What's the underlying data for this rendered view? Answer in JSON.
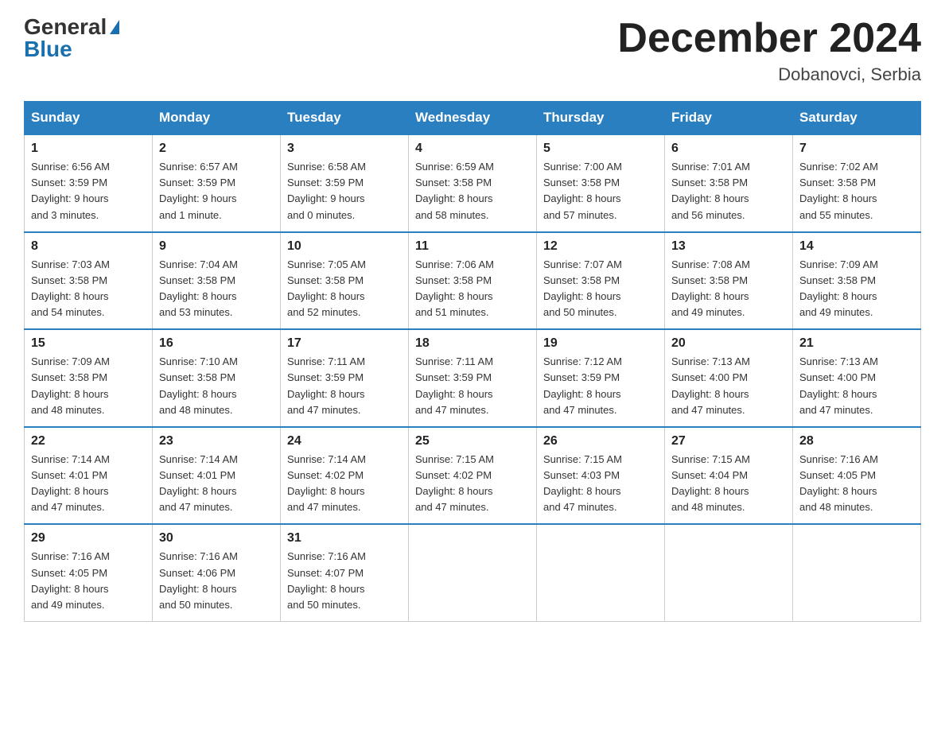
{
  "header": {
    "logo_general": "General",
    "logo_blue": "Blue",
    "month_title": "December 2024",
    "location": "Dobanovci, Serbia"
  },
  "weekdays": [
    "Sunday",
    "Monday",
    "Tuesday",
    "Wednesday",
    "Thursday",
    "Friday",
    "Saturday"
  ],
  "weeks": [
    [
      {
        "day": "1",
        "info": "Sunrise: 6:56 AM\nSunset: 3:59 PM\nDaylight: 9 hours\nand 3 minutes."
      },
      {
        "day": "2",
        "info": "Sunrise: 6:57 AM\nSunset: 3:59 PM\nDaylight: 9 hours\nand 1 minute."
      },
      {
        "day": "3",
        "info": "Sunrise: 6:58 AM\nSunset: 3:59 PM\nDaylight: 9 hours\nand 0 minutes."
      },
      {
        "day": "4",
        "info": "Sunrise: 6:59 AM\nSunset: 3:58 PM\nDaylight: 8 hours\nand 58 minutes."
      },
      {
        "day": "5",
        "info": "Sunrise: 7:00 AM\nSunset: 3:58 PM\nDaylight: 8 hours\nand 57 minutes."
      },
      {
        "day": "6",
        "info": "Sunrise: 7:01 AM\nSunset: 3:58 PM\nDaylight: 8 hours\nand 56 minutes."
      },
      {
        "day": "7",
        "info": "Sunrise: 7:02 AM\nSunset: 3:58 PM\nDaylight: 8 hours\nand 55 minutes."
      }
    ],
    [
      {
        "day": "8",
        "info": "Sunrise: 7:03 AM\nSunset: 3:58 PM\nDaylight: 8 hours\nand 54 minutes."
      },
      {
        "day": "9",
        "info": "Sunrise: 7:04 AM\nSunset: 3:58 PM\nDaylight: 8 hours\nand 53 minutes."
      },
      {
        "day": "10",
        "info": "Sunrise: 7:05 AM\nSunset: 3:58 PM\nDaylight: 8 hours\nand 52 minutes."
      },
      {
        "day": "11",
        "info": "Sunrise: 7:06 AM\nSunset: 3:58 PM\nDaylight: 8 hours\nand 51 minutes."
      },
      {
        "day": "12",
        "info": "Sunrise: 7:07 AM\nSunset: 3:58 PM\nDaylight: 8 hours\nand 50 minutes."
      },
      {
        "day": "13",
        "info": "Sunrise: 7:08 AM\nSunset: 3:58 PM\nDaylight: 8 hours\nand 49 minutes."
      },
      {
        "day": "14",
        "info": "Sunrise: 7:09 AM\nSunset: 3:58 PM\nDaylight: 8 hours\nand 49 minutes."
      }
    ],
    [
      {
        "day": "15",
        "info": "Sunrise: 7:09 AM\nSunset: 3:58 PM\nDaylight: 8 hours\nand 48 minutes."
      },
      {
        "day": "16",
        "info": "Sunrise: 7:10 AM\nSunset: 3:58 PM\nDaylight: 8 hours\nand 48 minutes."
      },
      {
        "day": "17",
        "info": "Sunrise: 7:11 AM\nSunset: 3:59 PM\nDaylight: 8 hours\nand 47 minutes."
      },
      {
        "day": "18",
        "info": "Sunrise: 7:11 AM\nSunset: 3:59 PM\nDaylight: 8 hours\nand 47 minutes."
      },
      {
        "day": "19",
        "info": "Sunrise: 7:12 AM\nSunset: 3:59 PM\nDaylight: 8 hours\nand 47 minutes."
      },
      {
        "day": "20",
        "info": "Sunrise: 7:13 AM\nSunset: 4:00 PM\nDaylight: 8 hours\nand 47 minutes."
      },
      {
        "day": "21",
        "info": "Sunrise: 7:13 AM\nSunset: 4:00 PM\nDaylight: 8 hours\nand 47 minutes."
      }
    ],
    [
      {
        "day": "22",
        "info": "Sunrise: 7:14 AM\nSunset: 4:01 PM\nDaylight: 8 hours\nand 47 minutes."
      },
      {
        "day": "23",
        "info": "Sunrise: 7:14 AM\nSunset: 4:01 PM\nDaylight: 8 hours\nand 47 minutes."
      },
      {
        "day": "24",
        "info": "Sunrise: 7:14 AM\nSunset: 4:02 PM\nDaylight: 8 hours\nand 47 minutes."
      },
      {
        "day": "25",
        "info": "Sunrise: 7:15 AM\nSunset: 4:02 PM\nDaylight: 8 hours\nand 47 minutes."
      },
      {
        "day": "26",
        "info": "Sunrise: 7:15 AM\nSunset: 4:03 PM\nDaylight: 8 hours\nand 47 minutes."
      },
      {
        "day": "27",
        "info": "Sunrise: 7:15 AM\nSunset: 4:04 PM\nDaylight: 8 hours\nand 48 minutes."
      },
      {
        "day": "28",
        "info": "Sunrise: 7:16 AM\nSunset: 4:05 PM\nDaylight: 8 hours\nand 48 minutes."
      }
    ],
    [
      {
        "day": "29",
        "info": "Sunrise: 7:16 AM\nSunset: 4:05 PM\nDaylight: 8 hours\nand 49 minutes."
      },
      {
        "day": "30",
        "info": "Sunrise: 7:16 AM\nSunset: 4:06 PM\nDaylight: 8 hours\nand 50 minutes."
      },
      {
        "day": "31",
        "info": "Sunrise: 7:16 AM\nSunset: 4:07 PM\nDaylight: 8 hours\nand 50 minutes."
      },
      null,
      null,
      null,
      null
    ]
  ]
}
